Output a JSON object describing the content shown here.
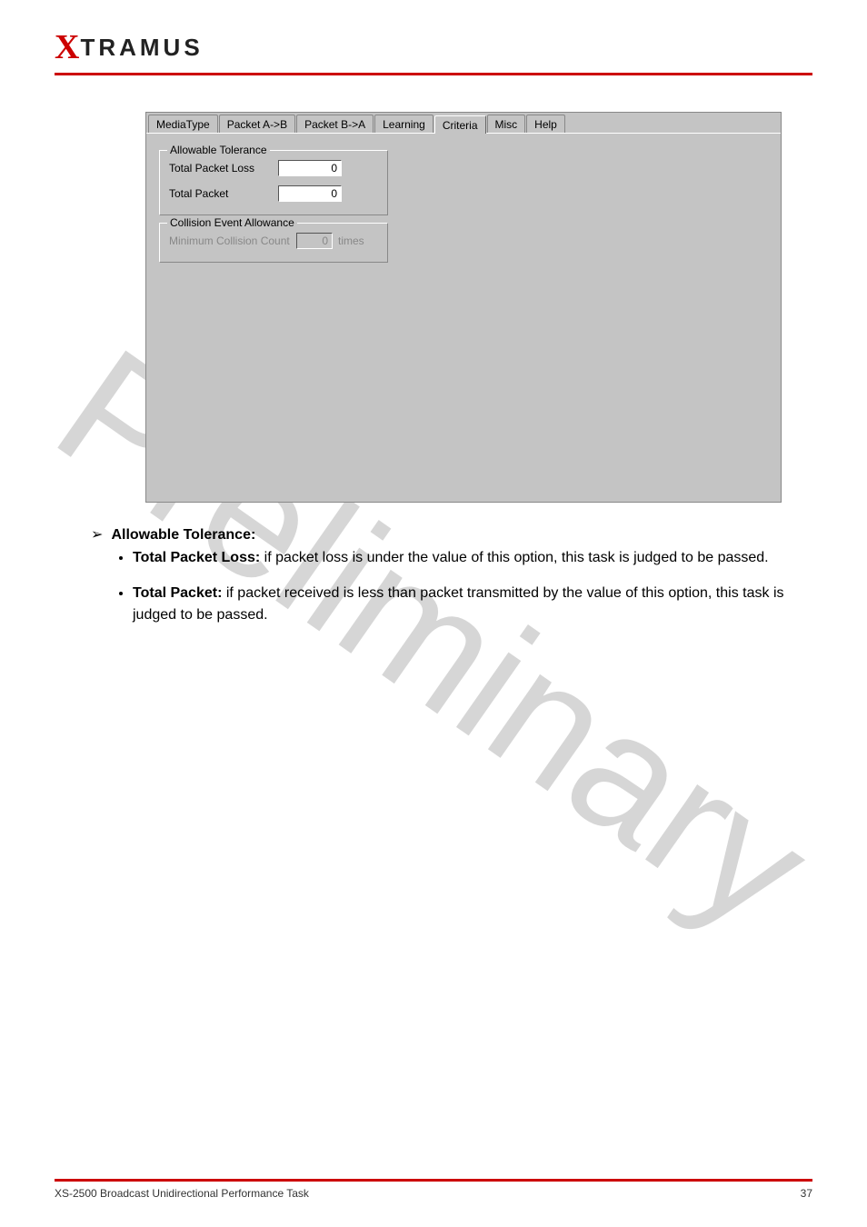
{
  "logo": {
    "x": "X",
    "rest": "TRAMUS"
  },
  "tabs": [
    {
      "label": "MediaType",
      "active": false
    },
    {
      "label": "Packet A->B",
      "active": false
    },
    {
      "label": "Packet B->A",
      "active": false
    },
    {
      "label": "Learning",
      "active": false
    },
    {
      "label": "Criteria",
      "active": true
    },
    {
      "label": "Misc",
      "active": false
    },
    {
      "label": "Help",
      "active": false
    }
  ],
  "groupbox1": {
    "legend": "Allowable Tolerance",
    "rows": [
      {
        "label": "Total Packet Loss",
        "value": "0"
      },
      {
        "label": "Total Packet",
        "value": "0"
      }
    ]
  },
  "groupbox2": {
    "legend": "Collision Event Allowance",
    "row": {
      "label": "Minimum Collision Count",
      "value": "0",
      "unit": "times"
    }
  },
  "doc": {
    "section_title": "Allowable Tolerance:",
    "bullets": [
      {
        "bold": "Total Packet Loss:",
        "rest": " if packet loss is under the value of this option, this task is judged to be passed."
      },
      {
        "bold": "Total Packet:",
        "rest": " if packet received is less than packet transmitted by the value of this option, this task is judged to be passed."
      }
    ]
  },
  "watermark": "Preliminary",
  "footer": {
    "left": "XS-2500 Broadcast Unidirectional Performance Task",
    "right": "37"
  }
}
